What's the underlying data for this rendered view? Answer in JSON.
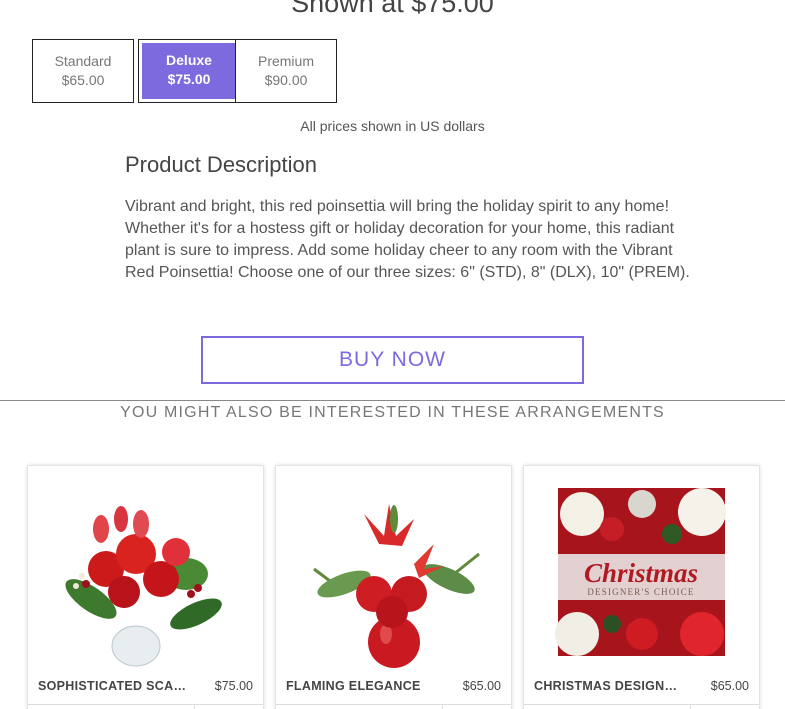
{
  "header": {
    "shown_at": "Shown at $75.00"
  },
  "size_options": [
    {
      "name": "Standard",
      "price": "$65.00",
      "selected": false
    },
    {
      "name": "Deluxe",
      "price": "$75.00",
      "selected": true
    },
    {
      "name": "Premium",
      "price": "$90.00",
      "selected": false
    }
  ],
  "currency_note": "All prices shown in US dollars",
  "description": {
    "title": "Product Description",
    "body": "Vibrant and bright, this red poinsettia will bring the holiday spirit to any home! Whether it's for a hostess gift or holiday decoration for your home, this radiant plant is sure to impress. Add some holiday cheer to any room with the Vibrant Red Poinsettia! Choose one of our three sizes: 6\" (STD), 8\" (DLX), 10\" (PREM)."
  },
  "buy_now_label": "BUY NOW",
  "related": {
    "heading": "YOU MIGHT ALSO BE INTERESTED IN THESE ARRANGEMENTS",
    "items": [
      {
        "name": "SOPHISTICATED SCARLET",
        "price": "$75.00",
        "image": "red-floral-arrangement-vase"
      },
      {
        "name": "FLAMING ELEGANCE",
        "price": "$65.00",
        "image": "red-lily-rose-bubble-bowl"
      },
      {
        "name": "CHRISTMAS DESIGNER'S CHOICE",
        "price": "$65.00",
        "image": "christmas-designers-choice-card",
        "image_text": {
          "script": "Christmas",
          "sub": "DESIGNER'S CHOICE"
        }
      }
    ]
  },
  "colors": {
    "accent": "#7d6ade",
    "text": "#444444"
  }
}
